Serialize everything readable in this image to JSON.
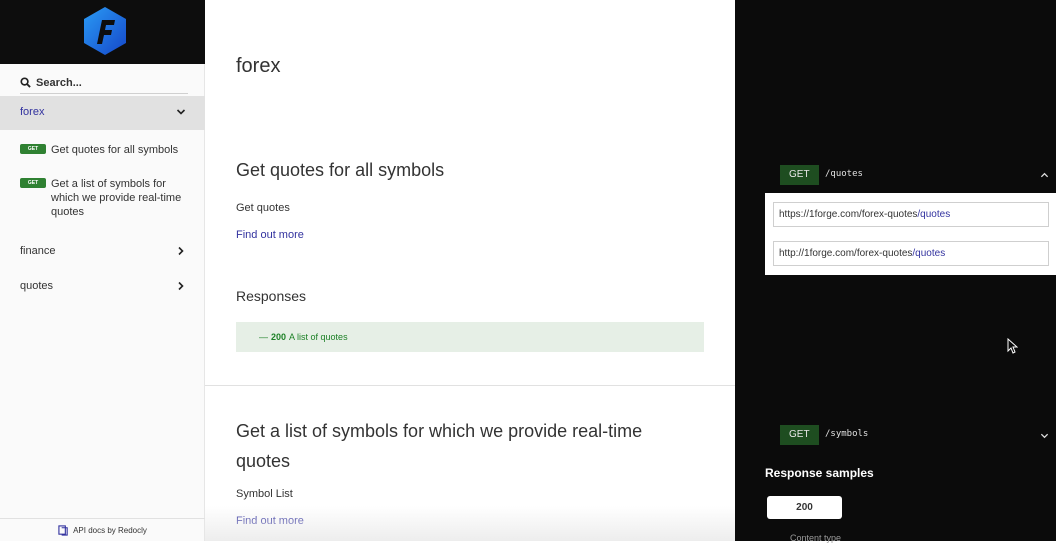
{
  "sidebar": {
    "search_placeholder": "Search...",
    "groups": [
      {
        "label": "forex",
        "active": true
      },
      {
        "label": "finance",
        "active": false
      },
      {
        "label": "quotes",
        "active": false
      }
    ],
    "operations": [
      {
        "method": "GET",
        "label": "Get quotes for all symbols"
      },
      {
        "method": "GET",
        "label": "Get a list of symbols for which we provide real-time quotes"
      }
    ],
    "footer": "API docs by Redocly"
  },
  "content": {
    "tag_title": "forex",
    "ops": [
      {
        "title": "Get quotes for all symbols",
        "summary": "Get quotes",
        "link": "Find out more"
      },
      {
        "title": "Get a list of symbols for which we provide real-time quotes",
        "summary": "Symbol List",
        "link": "Find out more"
      }
    ],
    "responses_title": "Responses",
    "response": {
      "prefix": "—",
      "code": "200",
      "text": "A list of quotes"
    }
  },
  "right": {
    "endpoints": [
      {
        "method": "GET",
        "path": "/quotes"
      },
      {
        "method": "GET",
        "path": "/symbols"
      }
    ],
    "servers": [
      {
        "base": "https://1forge.com/forex-quotes",
        "path": "/quotes"
      },
      {
        "base": "http://1forge.com/forex-quotes",
        "path": "/quotes"
      }
    ],
    "samples_title": "Response samples",
    "sample_tab": "200",
    "content_type_label": "Content type"
  },
  "colors": {
    "accent": "#32329f",
    "get_badge": "#2f8132",
    "success_text": "#1d8127",
    "right_panel": "#0b0b0b"
  }
}
